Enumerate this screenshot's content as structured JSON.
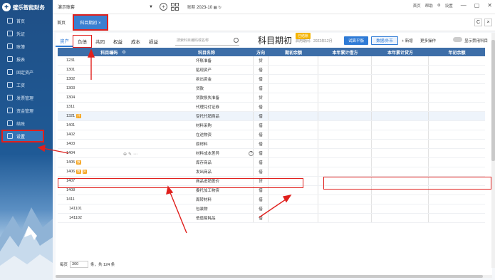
{
  "app": {
    "brand": "璧乐智能财务"
  },
  "sidebar": {
    "items": [
      {
        "label": "首页",
        "icon": "home-icon"
      },
      {
        "label": "凭证",
        "icon": "voucher-icon"
      },
      {
        "label": "账簿",
        "icon": "ledger-icon"
      },
      {
        "label": "报表",
        "icon": "report-icon"
      },
      {
        "label": "固定资产",
        "icon": "asset-icon"
      },
      {
        "label": "工资",
        "icon": "salary-icon"
      },
      {
        "label": "发票管理",
        "icon": "invoice-icon"
      },
      {
        "label": "资金管理",
        "icon": "fund-icon"
      },
      {
        "label": "结账",
        "icon": "close-icon"
      },
      {
        "label": "设置",
        "icon": "settings-icon"
      }
    ]
  },
  "topbar": {
    "account": "演示账套",
    "period_label": "账期",
    "period_value": "2023-10",
    "links": [
      "首页",
      "帮助",
      "设置"
    ]
  },
  "tabs": {
    "home": "首页",
    "active": "科目期初 ×"
  },
  "subtabs": [
    "资产",
    "负债",
    "共同",
    "权益",
    "成本",
    "损益"
  ],
  "search": {
    "placeholder": "搜索科目编码或名称"
  },
  "header": {
    "title": "科目期初",
    "status": "已结账",
    "period": "启用期间：2022年12月",
    "trial_balance": "试算平衡",
    "data_button": "数据/外币",
    "add": "+ 新增",
    "more": "更多操作",
    "show_disabled": "显示禁用科目"
  },
  "table": {
    "columns": [
      "科目编码",
      "科目名称",
      "方向",
      "期初余额",
      "本年累计借方",
      "本年累计贷方",
      "年初余额"
    ],
    "rows": [
      {
        "code": "1231",
        "name": "坏账准备",
        "dir": "贷",
        "tag": ""
      },
      {
        "code": "1301",
        "name": "贴现资产",
        "dir": "借",
        "tag": ""
      },
      {
        "code": "1302",
        "name": "拆出资金",
        "dir": "借",
        "tag": ""
      },
      {
        "code": "1303",
        "name": "贷款",
        "dir": "借",
        "tag": ""
      },
      {
        "code": "1304",
        "name": "贷款损失准备",
        "dir": "贷",
        "tag": ""
      },
      {
        "code": "1311",
        "name": "代理兑付证券",
        "dir": "借",
        "tag": ""
      },
      {
        "code": "1321",
        "name": "受托代销商品",
        "dir": "借",
        "tag": "外"
      },
      {
        "code": "1401",
        "name": "材料采购",
        "dir": "借",
        "tag": ""
      },
      {
        "code": "1402",
        "name": "在途物资",
        "dir": "借",
        "tag": ""
      },
      {
        "code": "1403",
        "name": "原材料",
        "dir": "借",
        "tag": ""
      },
      {
        "code": "1404",
        "name": "材料成本差异",
        "dir": "借",
        "tag": ""
      },
      {
        "code": "1405",
        "name": "库存商品",
        "dir": "借",
        "tag": "数"
      },
      {
        "code": "1406",
        "name": "发出商品",
        "dir": "借",
        "tag": "数 外"
      },
      {
        "code": "1407",
        "name": "商品进销差价",
        "dir": "贷",
        "tag": ""
      },
      {
        "code": "1408",
        "name": "委托加工物资",
        "dir": "借",
        "tag": ""
      },
      {
        "code": "1411",
        "name": "周转材料",
        "dir": "借",
        "tag": ""
      },
      {
        "code": "141101",
        "name": "包装物",
        "dir": "借",
        "tag": ""
      },
      {
        "code": "141102",
        "name": "低值易耗品",
        "dir": "借",
        "tag": ""
      }
    ]
  },
  "footer": {
    "per_page_label": "每页",
    "per_page": "300",
    "total": "条，共 124 条"
  },
  "colors": {
    "primary": "#2f7bd6",
    "sidebar": "#1f4f86",
    "annotation": "#e0201d",
    "tag": "#f5a623"
  }
}
